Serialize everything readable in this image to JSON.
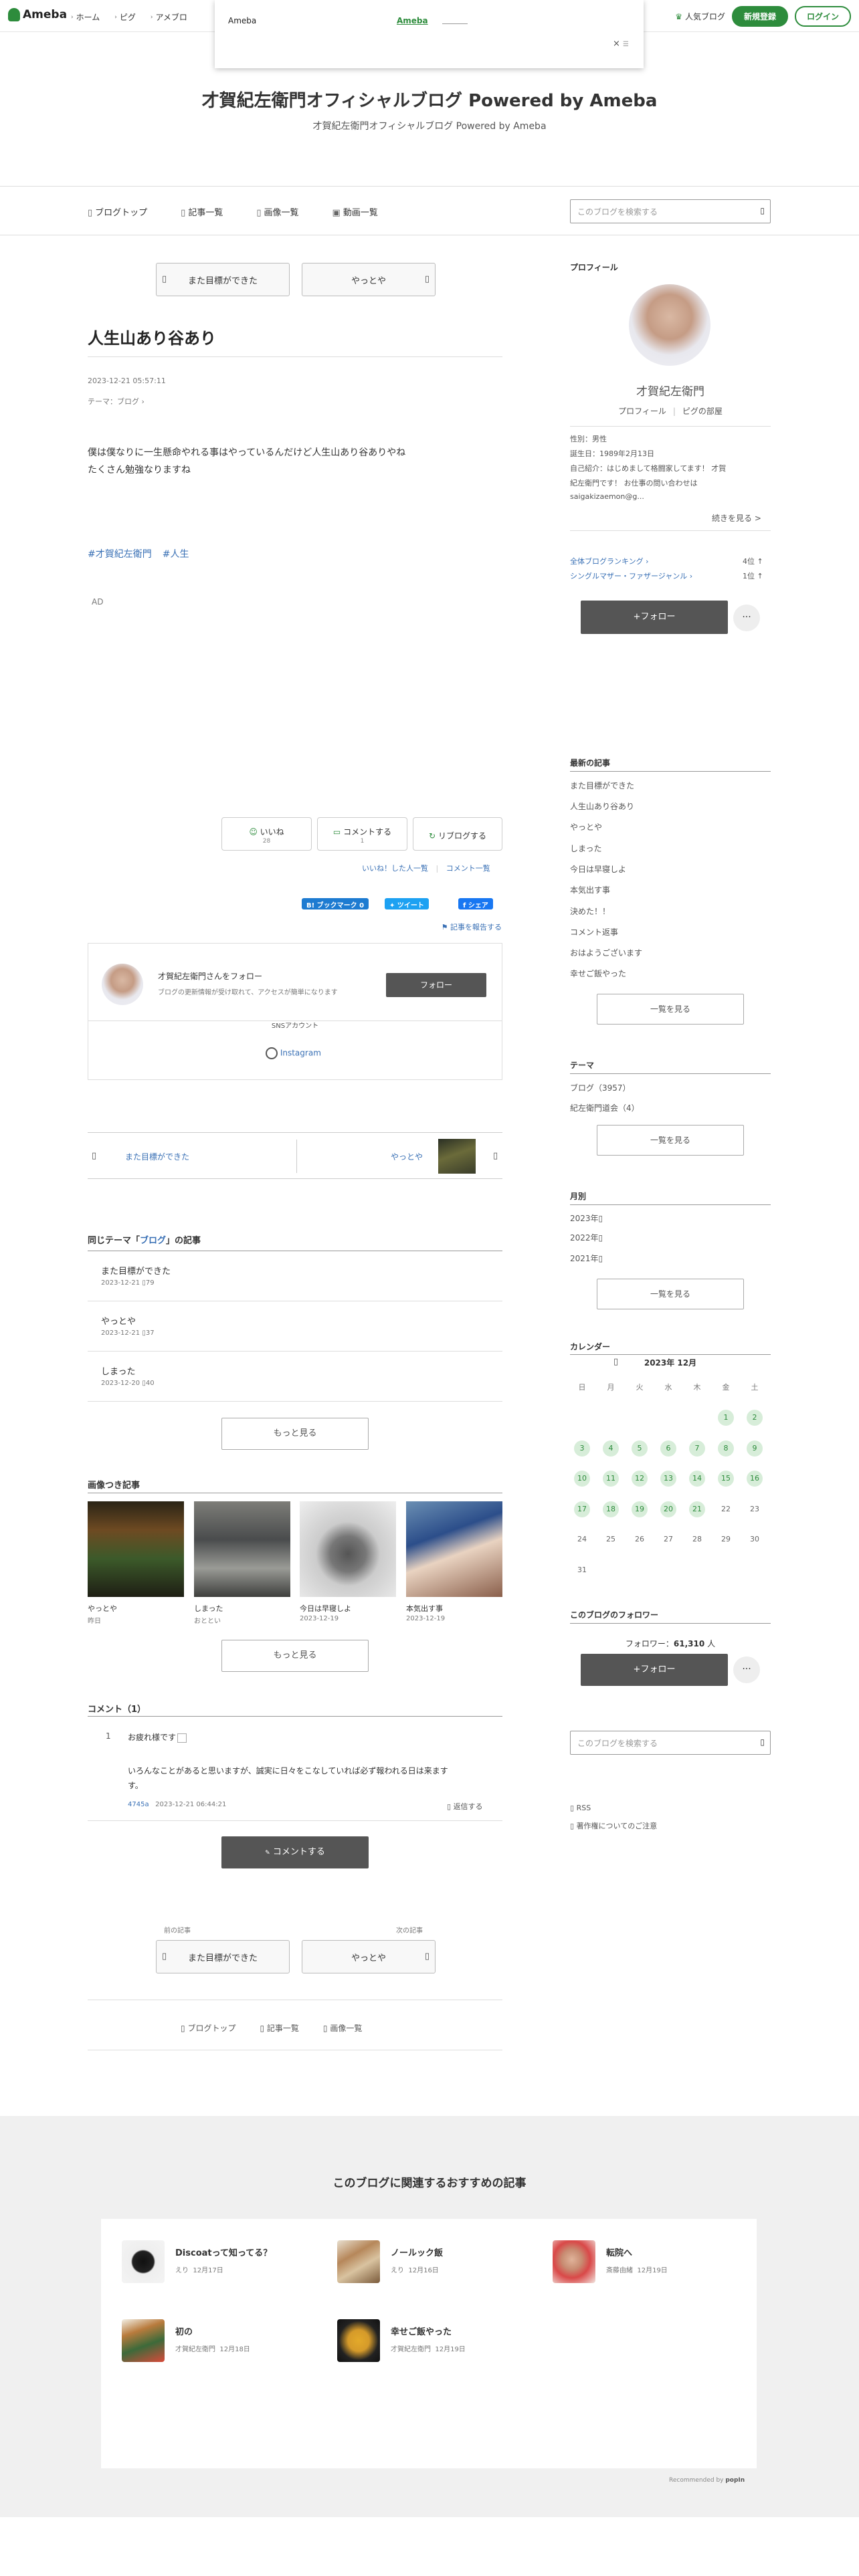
{
  "header": {
    "logo": "Ameba",
    "nav": [
      "ホーム",
      "ピグ",
      "アメブロ"
    ],
    "popular": "人気ブログ",
    "signup": "新規登録",
    "login": "ログイン"
  },
  "overlay": {
    "title": "Ameba",
    "link": "Ameba",
    "close": "×"
  },
  "blog": {
    "title": "才賀紀左衛門オフィシャルブログ Powered by Ameba",
    "subtitle": "才賀紀左衛門オフィシャルブログ Powered by Ameba"
  },
  "gnav": [
    "ブログトップ",
    "記事一覧",
    "画像一覧",
    "動画一覧"
  ],
  "search": {
    "placeholder": "このブログを検索する"
  },
  "post": {
    "prev_top": "また目標ができた",
    "next_top": "やっとや",
    "title": "人生山あり谷あり",
    "datetime": "2023-12-21 05:57:11",
    "theme": "テーマ：ブログ",
    "body_line1": "僕は僕なりに一生懸命やれる事はやっているんだけど人生山あり谷ありやね",
    "body_line2": "たくさん勉強なりますね",
    "tags": [
      "#才賀紀左衛門",
      "#人生"
    ],
    "ad": "AD"
  },
  "actions": {
    "like": "いいね",
    "like_count": "28",
    "comment": "コメントする",
    "comment_count": "1",
    "reblog": "リブログする",
    "liked_users": "いいね！した人一覧",
    "comment_list": "コメント一覧",
    "hatena": "B! ブックマーク",
    "hatena_count": "0",
    "tweet": "ツイート",
    "fb_share": "シェア",
    "report": "記事を報告する"
  },
  "follow_box": {
    "name": "才賀紀左衛門さんをフォロー",
    "desc": "ブログの更新情報が受け取れて、アクセスが簡単になります",
    "follow": "フォロー",
    "sns": "SNSアカウント",
    "instagram": "Instagram"
  },
  "prevnext": {
    "prev": "また目標ができた",
    "next": "やっとや"
  },
  "related": {
    "heading_pre": "同じテーマ「",
    "heading_theme": "ブログ",
    "heading_post": "」の記事",
    "items": [
      {
        "title": "また目標ができた",
        "date": "2023-12-21",
        "count": "79"
      },
      {
        "title": "やっとや",
        "date": "2023-12-21",
        "count": "37"
      },
      {
        "title": "しまった",
        "date": "2023-12-20",
        "count": "40"
      }
    ],
    "more": "もっと見る"
  },
  "images": {
    "heading": "画像つき記事",
    "items": [
      {
        "caption": "やっとや",
        "date": "昨日"
      },
      {
        "caption": "しまった",
        "date": "おととい"
      },
      {
        "caption": "今日は早寝しよ",
        "date": "2023-12-19"
      },
      {
        "caption": "本気出す事",
        "date": "2023-12-19"
      }
    ],
    "more": "もっと見る"
  },
  "comments": {
    "heading": "コメント（1）",
    "number": "1",
    "title": "お疲れ様です",
    "text1": "いろんなことがあると思いますが、誠実に日々をこなしていれば必ず報われる日は来ます",
    "text2": "す。",
    "user": "4745a",
    "date": "2023-12-21 06:44:21",
    "reply": "返信する",
    "button": "コメントする"
  },
  "bottom_nav": {
    "prev_label": "前の記事",
    "next_label": "次の記事",
    "prev": "また目標ができた",
    "next": "やっとや",
    "links": [
      "ブログトップ",
      "記事一覧",
      "画像一覧"
    ]
  },
  "sidebar": {
    "profile_heading": "プロフィール",
    "name": "才賀紀左衛門",
    "profile_link": "プロフィール",
    "pig_link": "ピグの部屋",
    "gender": "性別：男性",
    "birthday": "誕生日：1989年2月13日",
    "intro1": "自己紹介：はじめまして格闘家してます！ 才賀",
    "intro2": "紀左衛門です！ お仕事の問い合わせは",
    "intro3": "saigakizaemon@g...",
    "more": "続きを見る >",
    "rank1_label": "全体ブログランキング",
    "rank1_value": "4位",
    "rank2_label": "シングルマザー・ファザージャンル",
    "rank2_value": "1位",
    "follow": "フォロー",
    "recent_heading": "最新の記事",
    "recent": [
      "また目標ができた",
      "人生山あり谷あり",
      "やっとや",
      "しまった",
      "今日は早寝しよ",
      "本気出す事",
      "決めた！！",
      "コメント返事",
      "おはようございます",
      "幸せご飯やった"
    ],
    "recent_more": "一覧を見る",
    "theme_heading": "テーマ",
    "themes": [
      "ブログ（3957）",
      "紀左衛門道会（4）"
    ],
    "theme_more": "一覧を見る",
    "month_heading": "月別",
    "months": [
      "2023年",
      "2022年",
      "2021年"
    ],
    "month_more": "一覧を見る",
    "calendar_heading": "カレンダー",
    "calendar_title": "2023年 12月",
    "weekdays": [
      "日",
      "月",
      "火",
      "水",
      "木",
      "金",
      "土"
    ],
    "days": [
      [
        "",
        "",
        "",
        "",
        "",
        "1",
        "2"
      ],
      [
        "3",
        "4",
        "5",
        "6",
        "7",
        "8",
        "9"
      ],
      [
        "10",
        "11",
        "12",
        "13",
        "14",
        "15",
        "16"
      ],
      [
        "17",
        "18",
        "19",
        "20",
        "21",
        "22",
        "23"
      ],
      [
        "24",
        "25",
        "26",
        "27",
        "28",
        "29",
        "30"
      ],
      [
        "31",
        "",
        "",
        "",
        "",
        "",
        ""
      ]
    ],
    "follower_heading": "このブログのフォロワー",
    "follower_label": "フォロワー：",
    "follower_count": "61,310",
    "follower_unit": "人",
    "follow2": "フォロー",
    "rss": "RSS",
    "copyright": "著作権についてのご注意"
  },
  "recommend": {
    "heading": "このブログに関連するおすすめの記事",
    "items": [
      {
        "title": "Discoatって知ってる？",
        "author": "えり",
        "date": "12月17日"
      },
      {
        "title": "ノールック飯",
        "author": "えり",
        "date": "12月16日"
      },
      {
        "title": "転院へ",
        "author": "斎藤由緒",
        "date": "12月19日"
      },
      {
        "title": "初の",
        "author": "才賀紀左衛門",
        "date": "12月18日"
      },
      {
        "title": "幸せご飯やった",
        "author": "才賀紀左衛門",
        "date": "12月19日"
      }
    ],
    "powered": "Recommended by",
    "popin": "popIn"
  }
}
